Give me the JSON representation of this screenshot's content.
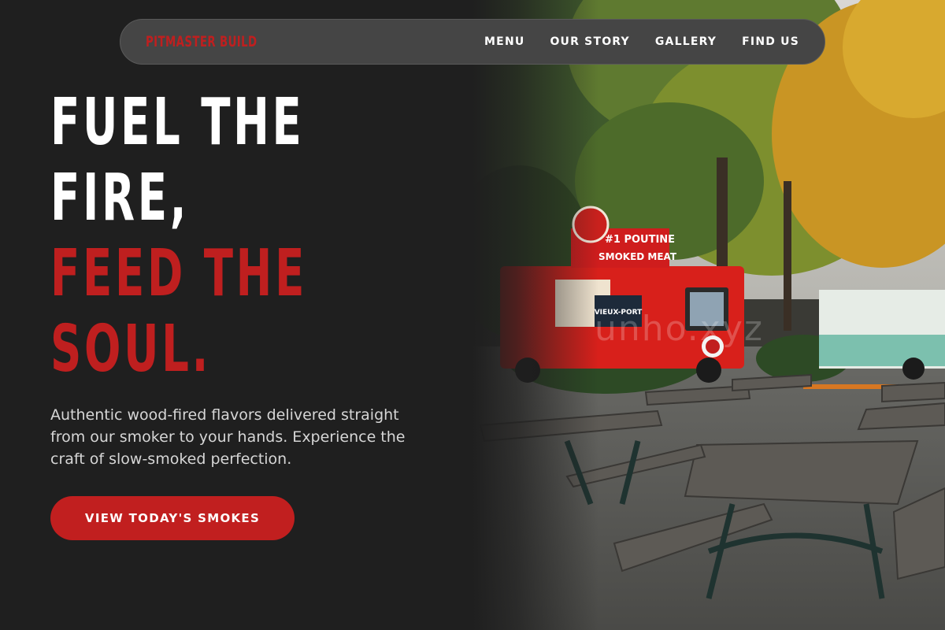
{
  "brand": {
    "name": "PITMASTER BUILD",
    "color": "#bf1f1f"
  },
  "nav": {
    "items": [
      {
        "label": "MENU"
      },
      {
        "label": "OUR STORY"
      },
      {
        "label": "GALLERY"
      },
      {
        "label": "FIND US"
      }
    ]
  },
  "hero": {
    "headline_line1": "FUEL THE",
    "headline_line2": "FIRE,",
    "headline_line3": "FEED THE",
    "headline_line4": "SOUL.",
    "subtitle": "Authentic wood-fired flavors delivered straight from our smoker to your hands. Experience the craft of slow-smoked perfection.",
    "cta_label": "VIEW TODAY'S SMOKES",
    "accent_color": "#c11f1f"
  },
  "photo": {
    "watermark": "unho.xyz",
    "truck_sign": "#1 POUTINE",
    "truck_sign2": "SMOKED MEAT",
    "truck_badge": "VIEUX-PORT"
  }
}
